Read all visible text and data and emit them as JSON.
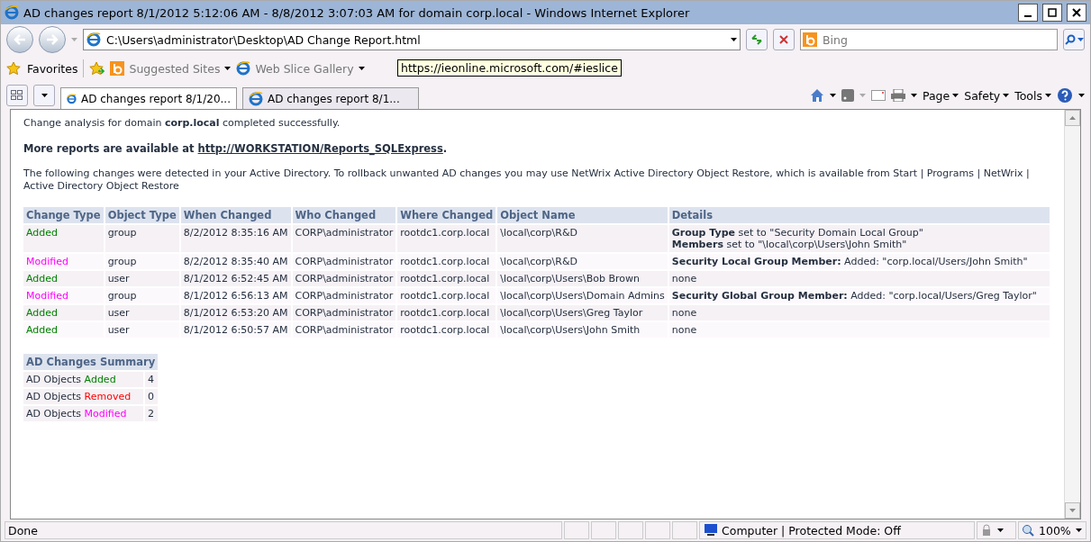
{
  "window": {
    "title": "AD changes report 8/1/2012 5:12:06 AM - 8/8/2012 3:07:03 AM for domain corp.local - Windows Internet Explorer"
  },
  "address_bar": {
    "value": "C:\\Users\\administrator\\Desktop\\AD Change Report.html"
  },
  "search": {
    "placeholder": "Bing"
  },
  "favorites_bar": {
    "label": "Favorites",
    "items": [
      "Suggested Sites",
      "Web Slice Gallery"
    ]
  },
  "tooltip": "https://ieonline.microsoft.com/#ieslice",
  "tabs": [
    {
      "label": "AD changes report 8/1/20...",
      "selected": true
    },
    {
      "label": "AD changes report 8/1...",
      "selected": false
    }
  ],
  "command_bar": [
    "Page",
    "Safety",
    "Tools"
  ],
  "report": {
    "status": "Change analysis for domain **corp.local** completed successfully.",
    "more_reports": "More reports are available at",
    "more_reports_link": "http://WORKSTATION/Reports_SQLExpress",
    "more_reports_end": ".",
    "intro": "The following changes were detected in your Active Directory. To rollback unwanted AD changes you may use NetWrix Active Directory Object Restore, which is available from Start | Programs | NetWrix | Active Directory Object Restore",
    "table": {
      "columns": [
        "Change Type",
        "Object Type",
        "When Changed",
        "Who Changed",
        "Where Changed",
        "Object Name",
        "Details"
      ],
      "rows": [
        {
          "change_type": "Added",
          "kind": "added",
          "object_type": "group",
          "when": "8/2/2012 8:35:16 AM",
          "who": "CORP\\administrator",
          "where": "rootdc1.corp.local",
          "object_name": "\\local\\corp\\R&D",
          "details": [
            "**Group Type** set to \"Security Domain Local Group\"",
            "**Members** set to \"\\local\\corp\\Users\\John Smith\""
          ]
        },
        {
          "change_type": "Modified",
          "kind": "modified",
          "object_type": "group",
          "when": "8/2/2012 8:35:40 AM",
          "who": "CORP\\administrator",
          "where": "rootdc1.corp.local",
          "object_name": "\\local\\corp\\R&D",
          "details": [
            "**Security Local Group Member:** Added: \"corp.local/Users/John Smith\""
          ]
        },
        {
          "change_type": "Added",
          "kind": "added",
          "object_type": "user",
          "when": "8/1/2012 6:52:45 AM",
          "who": "CORP\\administrator",
          "where": "rootdc1.corp.local",
          "object_name": "\\local\\corp\\Users\\Bob Brown",
          "details": [
            "none"
          ]
        },
        {
          "change_type": "Modified",
          "kind": "modified",
          "object_type": "group",
          "when": "8/1/2012 6:56:13 AM",
          "who": "CORP\\administrator",
          "where": "rootdc1.corp.local",
          "object_name": "\\local\\corp\\Users\\Domain Admins",
          "details": [
            "**Security Global Group Member:** Added: \"corp.local/Users/Greg Taylor\""
          ]
        },
        {
          "change_type": "Added",
          "kind": "added",
          "object_type": "user",
          "when": "8/1/2012 6:53:20 AM",
          "who": "CORP\\administrator",
          "where": "rootdc1.corp.local",
          "object_name": "\\local\\corp\\Users\\Greg Taylor",
          "details": [
            "none"
          ]
        },
        {
          "change_type": "Added",
          "kind": "added",
          "object_type": "user",
          "when": "8/1/2012 6:50:57 AM",
          "who": "CORP\\administrator",
          "where": "rootdc1.corp.local",
          "object_name": "\\local\\corp\\Users\\John Smith",
          "details": [
            "none"
          ]
        }
      ]
    },
    "summary": {
      "title": "AD Changes Summary",
      "rows": [
        {
          "prefix": "AD Objects",
          "word": "Added",
          "kind": "added",
          "count": "4"
        },
        {
          "prefix": "AD Objects",
          "word": "Removed",
          "kind": "removed",
          "count": "0"
        },
        {
          "prefix": "AD Objects",
          "word": "Modified",
          "kind": "modified",
          "count": "2"
        }
      ]
    }
  },
  "status_bar": {
    "status": "Done",
    "zone": "Computer | Protected Mode: Off",
    "zoom": "100%"
  }
}
